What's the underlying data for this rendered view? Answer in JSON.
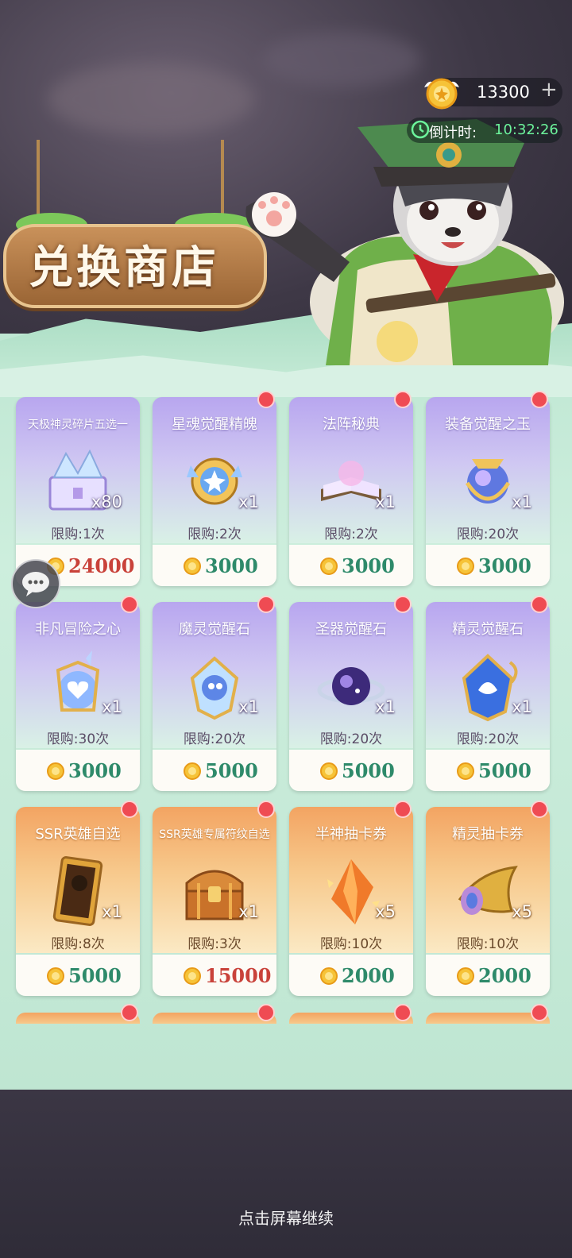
{
  "header": {
    "currency_amount": "13300",
    "currency_add": "+",
    "timer_label": "倒计时:",
    "timer_value": "10:32:26"
  },
  "sign": {
    "title": "兑换商店"
  },
  "items": [
    {
      "name": "天极神灵碎片五选一",
      "qty": "x80",
      "limit": "限购:1次",
      "price": "24000",
      "price_color": "red",
      "theme": "purple",
      "badge": false,
      "icon": "chest-icon"
    },
    {
      "name": "星魂觉醒精魄",
      "qty": "x1",
      "limit": "限购:2次",
      "price": "3000",
      "price_color": "green",
      "theme": "purple",
      "badge": true,
      "icon": "star-gem-icon"
    },
    {
      "name": "法阵秘典",
      "qty": "x1",
      "limit": "限购:2次",
      "price": "3000",
      "price_color": "green",
      "theme": "purple",
      "badge": true,
      "icon": "book-icon"
    },
    {
      "name": "装备觉醒之玉",
      "qty": "x1",
      "limit": "限购:20次",
      "price": "3000",
      "price_color": "green",
      "theme": "purple",
      "badge": true,
      "icon": "orb-icon"
    },
    {
      "name": "非凡冒险之心",
      "qty": "x1",
      "limit": "限购:30次",
      "price": "3000",
      "price_color": "green",
      "theme": "purple",
      "badge": true,
      "icon": "heart-orb-icon"
    },
    {
      "name": "魔灵觉醒石",
      "qty": "x1",
      "limit": "限购:20次",
      "price": "5000",
      "price_color": "green",
      "theme": "purple",
      "badge": true,
      "icon": "spirit-stone-icon"
    },
    {
      "name": "圣器觉醒石",
      "qty": "x1",
      "limit": "限购:20次",
      "price": "5000",
      "price_color": "green",
      "theme": "purple",
      "badge": true,
      "icon": "galaxy-orb-icon"
    },
    {
      "name": "精灵觉醒石",
      "qty": "x1",
      "limit": "限购:20次",
      "price": "5000",
      "price_color": "green",
      "theme": "purple",
      "badge": true,
      "icon": "fairy-stone-icon"
    },
    {
      "name": "SSR英雄自选",
      "qty": "x1",
      "limit": "限购:8次",
      "price": "5000",
      "price_color": "green",
      "theme": "orange",
      "badge": true,
      "icon": "hero-card-icon"
    },
    {
      "name": "SSR英雄专属符纹自选",
      "qty": "x1",
      "limit": "限购:3次",
      "price": "15000",
      "price_color": "red",
      "theme": "orange",
      "badge": true,
      "icon": "treasure-chest-icon"
    },
    {
      "name": "半神抽卡券",
      "qty": "x5",
      "limit": "限购:10次",
      "price": "2000",
      "price_color": "green",
      "theme": "orange",
      "badge": true,
      "icon": "crystal-ticket-icon"
    },
    {
      "name": "精灵抽卡券",
      "qty": "x5",
      "limit": "限购:10次",
      "price": "2000",
      "price_color": "green",
      "theme": "orange",
      "badge": true,
      "icon": "horn-ticket-icon"
    }
  ],
  "footer": {
    "continue_text": "点击屏幕继续"
  },
  "colors": {
    "price_green": "#2e8a6a",
    "price_red": "#c9423a",
    "timer_green": "#6cf39b",
    "badge_red": "#ef4b53"
  }
}
